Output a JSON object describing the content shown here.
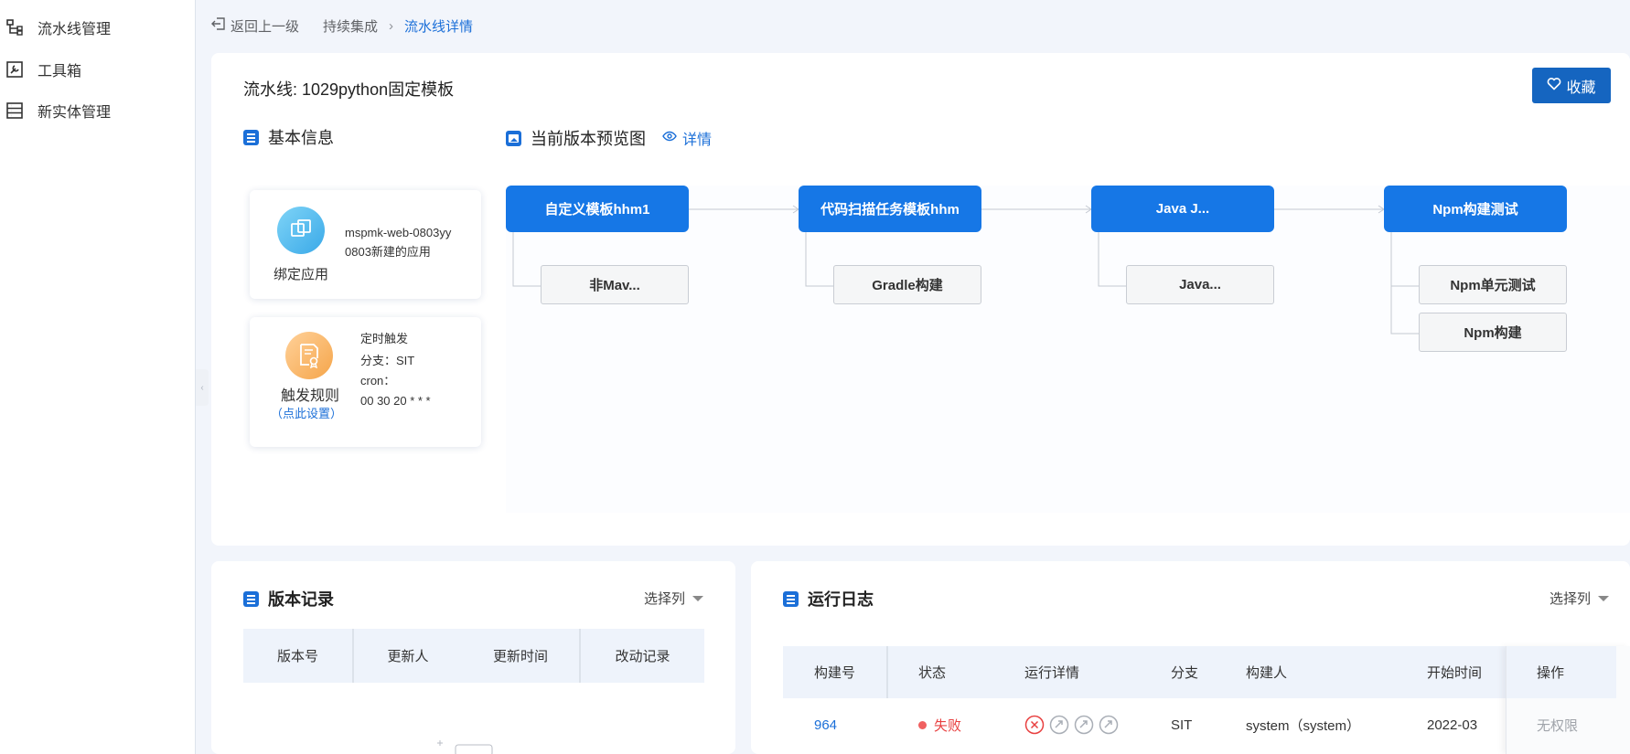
{
  "sidebar": {
    "items": [
      {
        "label": "流水线管理",
        "icon": "pipeline-icon"
      },
      {
        "label": "工具箱",
        "icon": "toolbox-icon"
      },
      {
        "label": "新实体管理",
        "icon": "entity-list-icon"
      }
    ]
  },
  "breadcrumb": {
    "back": "返回上一级",
    "parent": "持续集成",
    "current": "流水线详情"
  },
  "pipeline": {
    "title": "流水线: 1029python固定模板",
    "favorite_label": "收藏"
  },
  "basic_info": {
    "heading": "基本信息",
    "bind_app": {
      "label": "绑定应用",
      "app_code": "mspmk-web-0803yy",
      "app_desc": "0803新建的应用"
    },
    "trigger": {
      "label": "触发规则",
      "set_link": "（点此设置）",
      "line1": "定时触发",
      "line2": "分支：SIT",
      "line3": "cron：",
      "line4": "00 30 20 * * *"
    }
  },
  "preview": {
    "heading": "当前版本预览图",
    "detail_link": "详情",
    "stages": [
      {
        "name": "自定义模板hhm1",
        "tasks": [
          "非Mav..."
        ]
      },
      {
        "name": "代码扫描任务模板hhm",
        "tasks": [
          "Gradle构建"
        ]
      },
      {
        "name": "Java J...",
        "tasks": [
          "Java..."
        ]
      },
      {
        "name": "Npm构建测试",
        "tasks": [
          "Npm单元测试",
          "Npm构建"
        ]
      }
    ]
  },
  "version_records": {
    "heading": "版本记录",
    "column_select": "选择列",
    "columns": [
      "版本号",
      "更新人",
      "更新时间",
      "改动记录"
    ]
  },
  "run_logs": {
    "heading": "运行日志",
    "column_select": "选择列",
    "columns": [
      "构建号",
      "状态",
      "运行详情",
      "分支",
      "构建人",
      "开始时间",
      "操作"
    ],
    "rows": [
      {
        "build_no": "964",
        "status": "失败",
        "branch": "SIT",
        "builder": "system（system）",
        "start_time": "2022-03",
        "action": "无权限"
      }
    ]
  },
  "colors": {
    "primary": "#1677e6",
    "primary_dark": "#1565c0",
    "fail": "#e84040"
  }
}
